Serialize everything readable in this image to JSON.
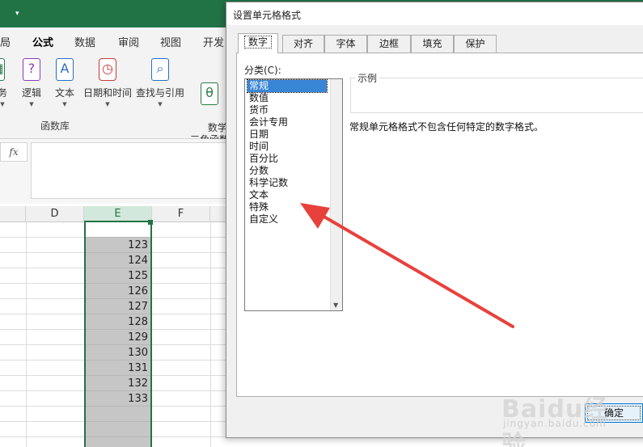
{
  "excel": {
    "ribbon_tabs": [
      "局",
      "公式",
      "数据",
      "审阅",
      "视图",
      "开发"
    ],
    "active_tab": "公式",
    "ribbon_buttons": [
      {
        "label": "务",
        "icon": "calendar-icon"
      },
      {
        "label": "逻辑",
        "icon": "logic-question-icon"
      },
      {
        "label": "文本",
        "icon": "text-a-icon"
      },
      {
        "label": "日期和时间",
        "icon": "clock-icon"
      },
      {
        "label": "查找与引用",
        "icon": "search-icon"
      },
      {
        "label": "数学和\n三角函数",
        "icon": "theta-icon"
      }
    ],
    "ribbon_group_label": "函数库",
    "fx_label": "fx",
    "columns": [
      "D",
      "E",
      "F"
    ],
    "column_e_values": [
      "123",
      "124",
      "125",
      "126",
      "127",
      "128",
      "129",
      "130",
      "131",
      "132",
      "133"
    ]
  },
  "dialog": {
    "title": "设置单元格格式",
    "tabs": [
      "数字",
      "对齐",
      "字体",
      "边框",
      "填充",
      "保护"
    ],
    "active_tab": "数字",
    "category_label": "分类(C):",
    "categories": [
      "常规",
      "数值",
      "货币",
      "会计专用",
      "日期",
      "时间",
      "百分比",
      "分数",
      "科学记数",
      "文本",
      "特殊",
      "自定义"
    ],
    "selected_category": "常规",
    "sample_label": "示例",
    "description": "常规单元格格式不包含任何特定的数字格式。",
    "ok_label": "确定"
  },
  "watermark": {
    "text": "Baidu经验",
    "sub": "jingyan.baidu.com"
  },
  "colors": {
    "excel_green": "#217346",
    "arrow": "#e8413c",
    "selection": "#3a86d6"
  }
}
